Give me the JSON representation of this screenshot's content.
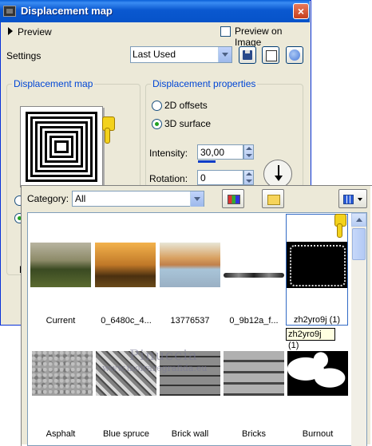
{
  "dialog": {
    "title": "Displacement map",
    "preview_label": "Preview",
    "preview_on_image_label": "Preview on Image",
    "settings_label": "Settings",
    "settings_value": "Last Used"
  },
  "displacement_map_group": {
    "title": "Displacement map",
    "side_label": "E"
  },
  "displacement_properties": {
    "title": "Displacement properties",
    "offsets_label": "2D offsets",
    "surface_label": "3D surface",
    "selected": "3D surface",
    "intensity_label": "Intensity:",
    "intensity_value": "30,00",
    "rotation_label": "Rotation:",
    "rotation_value": "0"
  },
  "browser": {
    "category_label": "Category:",
    "category_value": "All",
    "tooltip": "zh2yro9j (1)",
    "items": [
      {
        "label": "Current"
      },
      {
        "label": "0_6480c_4..."
      },
      {
        "label": "13776537"
      },
      {
        "label": "0_9b12a_f..."
      },
      {
        "label": "zh2yro9j (1)"
      },
      {
        "label": "Asphalt"
      },
      {
        "label": "Blue spruce"
      },
      {
        "label": "Brick wall"
      },
      {
        "label": "Bricks"
      },
      {
        "label": "Burnout"
      }
    ]
  },
  "watermark": {
    "name": "Pinuccia",
    "url": "www.moiraregrafida.eu"
  },
  "colors": {
    "title_bar": "#0a58d0",
    "accent_text": "#0046d5",
    "dialog_bg": "#ece9d8"
  }
}
